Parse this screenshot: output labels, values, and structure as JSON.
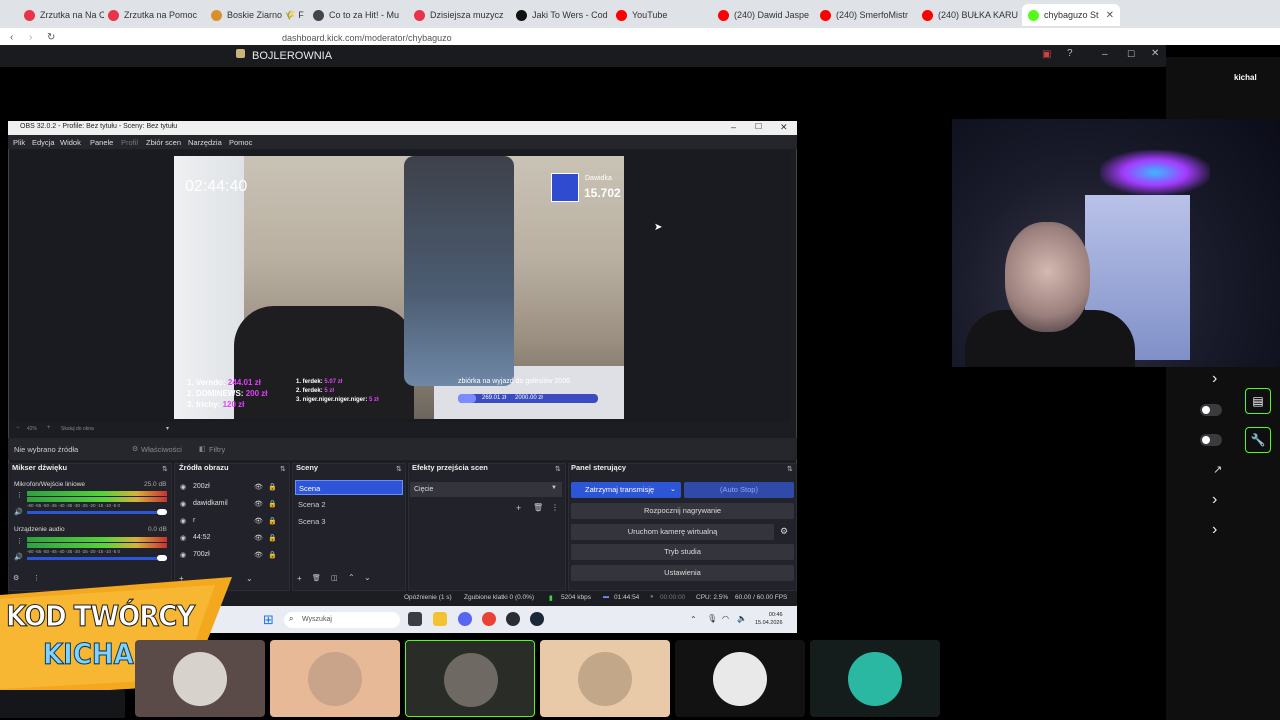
{
  "browser": {
    "tabs": [
      {
        "label": "Zrzutka na Na Cho",
        "color": "#e8334a"
      },
      {
        "label": "Zrzutka na Pomoc",
        "color": "#e8334a"
      },
      {
        "label": "Boskie Ziarno 🌾 F",
        "color": "#d9902a"
      },
      {
        "label": "Co to za Hit! - Mu",
        "color": "#444444"
      },
      {
        "label": "Dzisiejsza muzycz",
        "color": "#e8334a"
      },
      {
        "label": "Jaki To Wers - Cod",
        "color": "#111111"
      },
      {
        "label": "YouTube",
        "color": "#ff0000"
      },
      {
        "label": "(240) Dawid Jaspe",
        "color": "#ff0000"
      },
      {
        "label": "(240) SmerfoMistr",
        "color": "#ff0000"
      },
      {
        "label": "(240) BUŁKA KARU",
        "color": "#ff0000"
      },
      {
        "label": "chybaguzo St",
        "color": "#53fc18",
        "active": true
      }
    ],
    "url": "dashboard.kick.com/moderator/chybaguzo"
  },
  "app": {
    "title": "BOJLEROWNIA",
    "username": "kichal"
  },
  "obs": {
    "title": "OBS 32.0.2 - Profile: Bez tytułu - Sceny: Bez tytułu",
    "menu": [
      "Plik",
      "Edycja",
      "Widok",
      "Panele",
      "Profil",
      "Zbiór scen",
      "Narzędzia",
      "Pomoc"
    ],
    "zoom": "42%",
    "zoom_mode": "Skaluj do okna",
    "no_source": "Nie wybrano źródła",
    "properties": "Właściwości",
    "filters": "Filtry",
    "preview": {
      "timer": "02:44:40",
      "donor_name": "Dawidka",
      "donor_amount": "15.702",
      "leaderboard": [
        {
          "name": "1. Verndo:",
          "value": "244.01 zł"
        },
        {
          "name": "2. DOMINEWS:",
          "value": "200 zł"
        },
        {
          "name": "3. frichy:",
          "value": "120 zł"
        }
      ],
      "leaderboard2": [
        {
          "name": "1. ferdek:",
          "value": "5.07 zł"
        },
        {
          "name": "2. ferdek:",
          "value": "5 zł"
        },
        {
          "name": "3. niger.niger.niger.niger:",
          "value": "5 zł"
        }
      ],
      "goal_title": "zbiórka na wyjazd do golesiów 2006",
      "goal_current": "269.01 zł",
      "goal_target": "2000.00 zł",
      "goal_progress": 0.13
    },
    "docks": {
      "mixer": {
        "title": "Mikser dźwięku",
        "channels": [
          {
            "name": "Mikrofon/Wejście liniowe",
            "db": "25.0 dB"
          },
          {
            "name": "Urządzenie audio",
            "db": "0.0 dB"
          }
        ],
        "scale": "-60 -55 -50 -45 -40 -35 -30 -25 -20 -15 -10 -5 0"
      },
      "sources": {
        "title": "Źródła obrazu",
        "items": [
          "200zł",
          "dawidkamil",
          "r",
          "44:52",
          "700zł"
        ]
      },
      "scenes": {
        "title": "Sceny",
        "items": [
          "Scena",
          "Scena 2",
          "Scena 3"
        ]
      },
      "transitions": {
        "title": "Efekty przejścia scen",
        "selected": "Cięcie"
      },
      "controls": {
        "title": "Panel sterujący",
        "stream": "Zatrzymaj transmisję",
        "auto_stop": "(Auto Stop)",
        "buttons": [
          "Rozpocznij nagrywanie",
          "Uruchom kamerę wirtualną",
          "Tryb studia",
          "Ustawienia"
        ]
      }
    },
    "status": {
      "delay": "Opóźnienie (1 s)",
      "dropped": "Zgubione klatki 0 (0.0%)",
      "kbps": "5204 kbps",
      "live_time": "01:44:54",
      "rec_time": "00:00:00",
      "cpu": "CPU: 2.5%",
      "fps": "60.00 / 60.00 FPS"
    },
    "taskbar": {
      "search": "Wyszukaj",
      "time": "00:46",
      "date": "15.04.2026"
    }
  },
  "overlay": {
    "line1": "KOD TWÓRCY",
    "line2": "KICHAL"
  },
  "tiles": [
    {
      "bg": "#5a4a48",
      "ava": "#d8d2cc"
    },
    {
      "bg": "#e7b996",
      "ava": "#c9a38a"
    },
    {
      "bg": "#2a2c28",
      "ava": "#6e6a63"
    },
    {
      "bg": "#e8c9a8",
      "ava": "#c2a888"
    },
    {
      "bg": "#121212",
      "ava": "#e9e9e9"
    },
    {
      "bg": "#141d1c",
      "ava": "#2ab8a3"
    }
  ]
}
